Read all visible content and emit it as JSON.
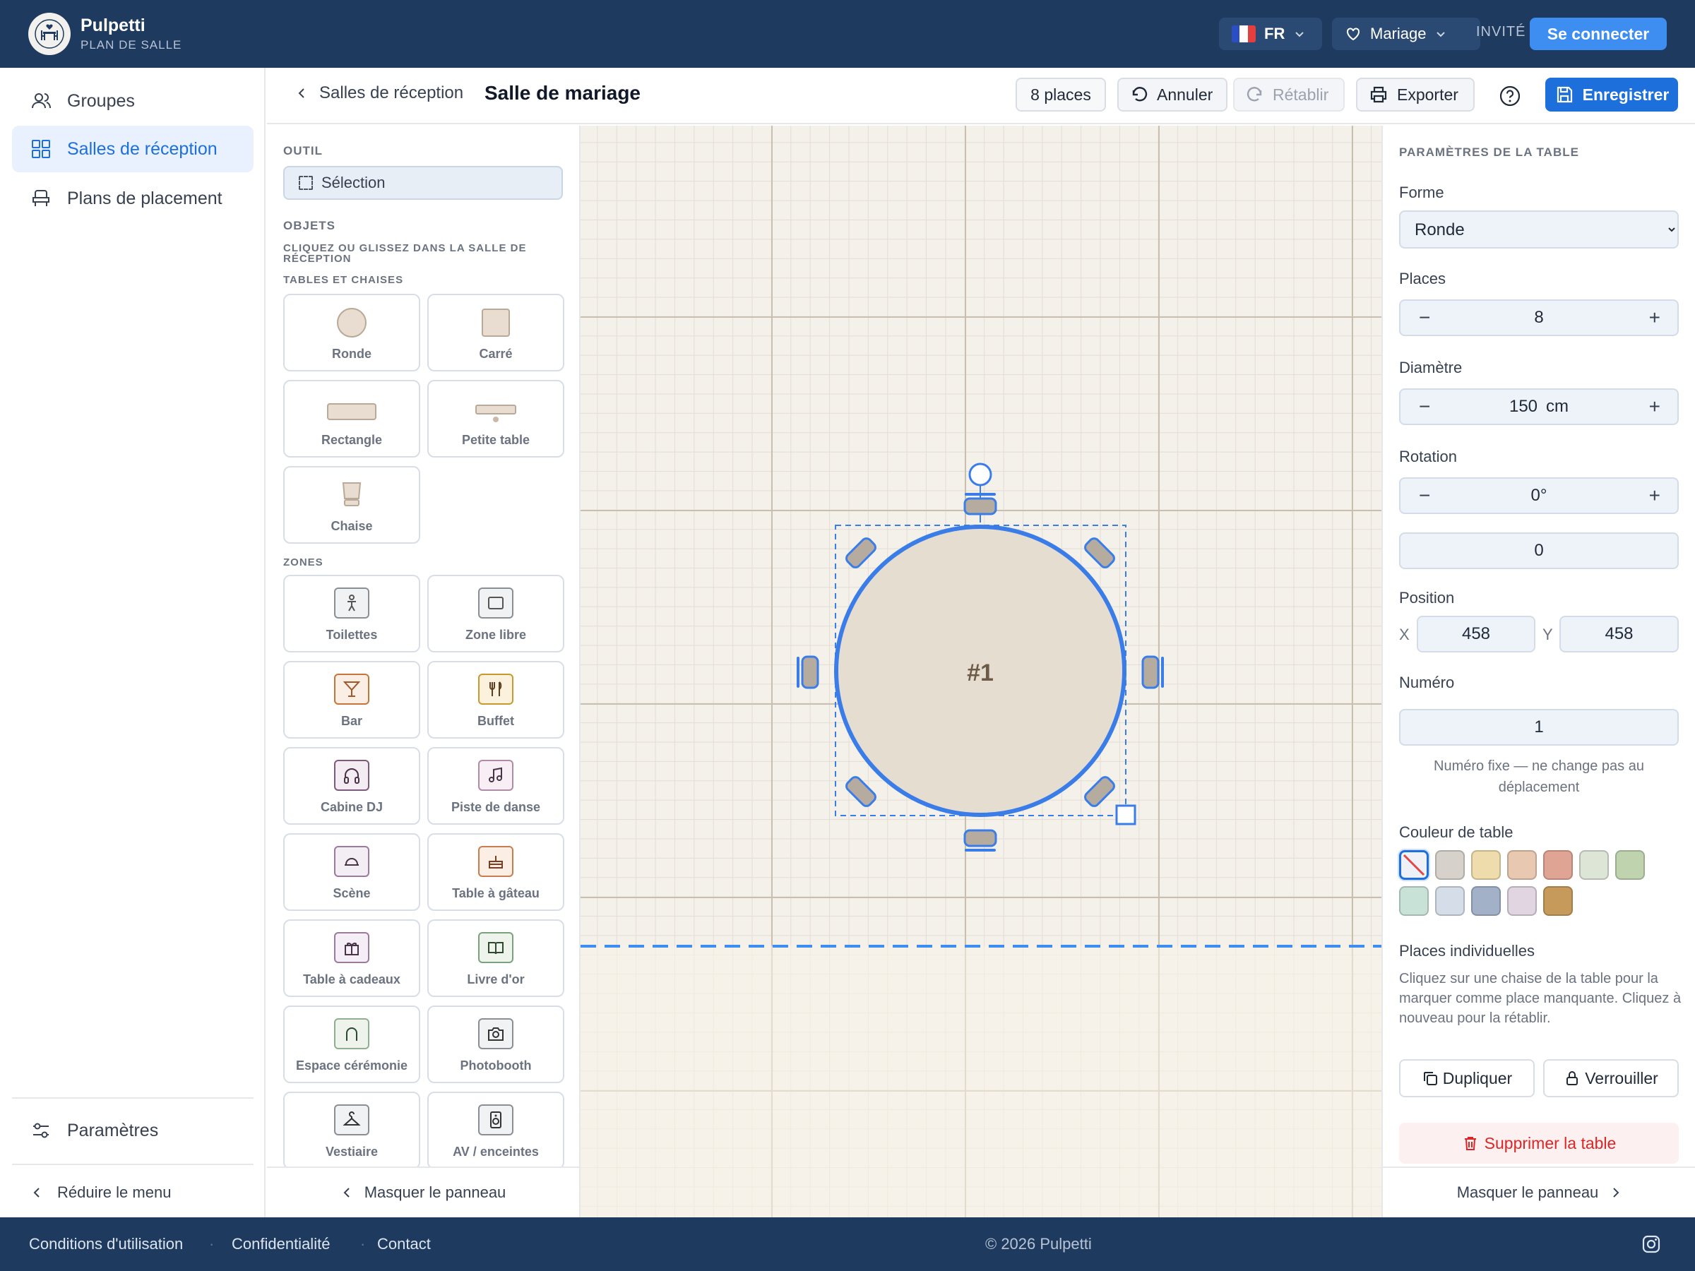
{
  "header": {
    "brand_name": "Pulpetti",
    "brand_subtitle": "PLAN DE SALLE",
    "logo_text": "PULPETTI",
    "language": "FR",
    "event": "Mariage",
    "role": "INVITÉ",
    "login_label": "Se connecter"
  },
  "sidebar": {
    "items": [
      {
        "label": "Groupes",
        "icon": "users-icon"
      },
      {
        "label": "Salles de réception",
        "icon": "grid-icon",
        "active": true
      },
      {
        "label": "Plans de placement",
        "icon": "seat-icon"
      }
    ],
    "settings_label": "Paramètres",
    "collapse_label": "Réduire le menu"
  },
  "toolbar": {
    "breadcrumb_back": "Salles de réception",
    "title": "Salle de mariage",
    "places_badge": "8 places",
    "undo_label": "Annuler",
    "redo_label": "Rétablir",
    "export_label": "Exporter",
    "save_label": "Enregistrer"
  },
  "left_panel": {
    "tool_heading": "OUTIL",
    "selection_label": "Sélection",
    "objects_heading": "OBJETS",
    "objects_hint": "CLIQUEZ OU GLISSEZ DANS LA SALLE DE RÉCEPTION",
    "tables_heading": "TABLES ET CHAISES",
    "tables": [
      "Ronde",
      "Carré",
      "Rectangle",
      "Petite table",
      "Chaise"
    ],
    "zones_heading": "ZONES",
    "zones": [
      "Toilettes",
      "Zone libre",
      "Bar",
      "Buffet",
      "Cabine DJ",
      "Piste de danse",
      "Scène",
      "Table à gâteau",
      "Table à cadeaux",
      "Livre d'or",
      "Espace cérémonie",
      "Photobooth",
      "Vestiaire",
      "AV / enceintes"
    ],
    "hide_panel_label": "Masquer le panneau"
  },
  "canvas": {
    "table_label": "#1"
  },
  "right_panel": {
    "heading": "PARAMÈTRES DE LA TABLE",
    "shape_label": "Forme",
    "shape_value": "Ronde",
    "shape_options": [
      "Ronde"
    ],
    "places_label": "Places",
    "places_value": "8",
    "diameter_label": "Diamètre",
    "diameter_value": "150",
    "diameter_unit": "cm",
    "rotation_label": "Rotation",
    "rotation_value": "0°",
    "rotation_input": "0",
    "position_label": "Position",
    "x_label": "X",
    "x_value": "458",
    "y_label": "Y",
    "y_value": "458",
    "number_label": "Numéro",
    "number_value": "1",
    "number_hint": "Numéro fixe — ne change pas au déplacement",
    "color_label": "Couleur de table",
    "colors": [
      "none",
      "#d6d1ca",
      "#efdcac",
      "#e8c8b0",
      "#e0a494",
      "#dde5d7",
      "#bfd3af",
      "#c8e2d8",
      "#d5dde8",
      "#a2b0c8",
      "#e0d5e0",
      "#c69a5a"
    ],
    "individual_label": "Places individuelles",
    "individual_hint": "Cliquez sur une chaise de la table pour la marquer comme place manquante. Cliquez à nouveau pour la rétablir.",
    "duplicate_label": "Dupliquer",
    "lock_label": "Verrouiller",
    "delete_label": "Supprimer la table",
    "hide_panel_label": "Masquer le panneau"
  },
  "footer": {
    "terms": "Conditions d'utilisation",
    "privacy": "Confidentialité",
    "contact": "Contact",
    "copyright": "© 2026 Pulpetti"
  }
}
